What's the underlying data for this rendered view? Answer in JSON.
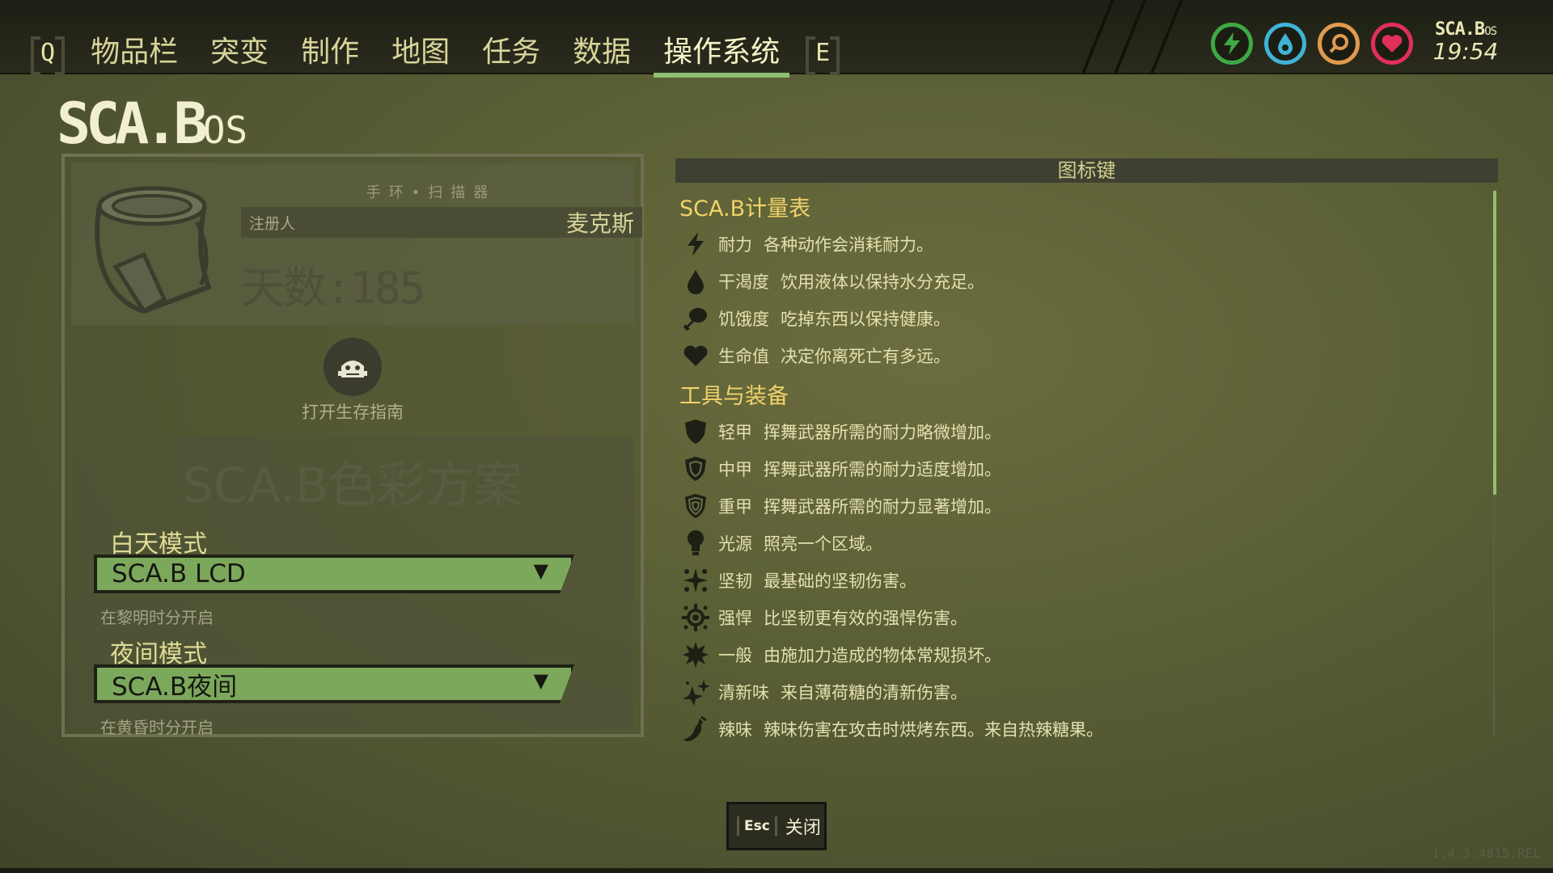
{
  "nav": {
    "left_key": "Q",
    "right_key": "E",
    "tabs": [
      "物品栏",
      "突变",
      "制作",
      "地图",
      "任务",
      "数据",
      "操作系统"
    ],
    "active_tab": "操作系统"
  },
  "status": {
    "icons": [
      {
        "name": "stamina-status-icon",
        "glyph": "⚡",
        "color": "#3fa845"
      },
      {
        "name": "thirst-status-icon",
        "glyph": "💧",
        "color": "#3fb4d6"
      },
      {
        "name": "hunger-status-icon",
        "glyph": "◔",
        "color": "#e09a4e"
      },
      {
        "name": "health-status-icon",
        "glyph": "♥",
        "color": "#e0305a"
      }
    ],
    "logo": "SCA.B",
    "logo_suffix": "OS",
    "time": "19:54"
  },
  "brand": {
    "logo": "SCA.B",
    "suffix": "OS"
  },
  "scanner": {
    "title": "手环•扫描器",
    "registrant_label": "注册人",
    "registrant_name": "麦克斯",
    "days": "天数:185"
  },
  "guide": {
    "label": "打开生存指南"
  },
  "color_scheme": {
    "title": "SCA.B色彩方案",
    "day": {
      "label": "白天模式",
      "value": "SCA.B LCD",
      "sub": "在黎明时分开启"
    },
    "night": {
      "label": "夜间模式",
      "value": "SCA.B夜间",
      "sub": "在黄昏时分开启"
    }
  },
  "legend": {
    "header": "图标键",
    "sections": [
      {
        "title": "SCA.B计量表",
        "items": [
          {
            "icon": "lightning-icon",
            "name": "耐力",
            "desc": "各种动作会消耗耐力。"
          },
          {
            "icon": "water-drop-icon",
            "name": "干渴度",
            "desc": "饮用液体以保持水分充足。"
          },
          {
            "icon": "drumstick-icon",
            "name": "饥饿度",
            "desc": "吃掉东西以保持健康。"
          },
          {
            "icon": "heart-icon",
            "name": "生命值",
            "desc": "决定你离死亡有多远。"
          }
        ]
      },
      {
        "title": "工具与装备",
        "items": [
          {
            "icon": "light-armor-shield-icon",
            "name": "轻甲",
            "desc": "挥舞武器所需的耐力略微增加。"
          },
          {
            "icon": "medium-armor-shield-icon",
            "name": "中甲",
            "desc": "挥舞武器所需的耐力适度增加。"
          },
          {
            "icon": "heavy-armor-shield-icon",
            "name": "重甲",
            "desc": "挥舞武器所需的耐力显著增加。"
          },
          {
            "icon": "light-source-bulb-icon",
            "name": "光源",
            "desc": "照亮一个区域。"
          },
          {
            "icon": "chop-damage-icon",
            "name": "坚韧",
            "desc": "最基础的坚韧伤害。"
          },
          {
            "icon": "bust-damage-icon",
            "name": "强悍",
            "desc": "比坚韧更有效的强悍伤害。"
          },
          {
            "icon": "generic-damage-burst-icon",
            "name": "一般",
            "desc": "由施加力造成的物体常规损坏。"
          },
          {
            "icon": "fresh-sparkle-icon",
            "name": "清新味",
            "desc": "来自薄荷糖的清新伤害。"
          },
          {
            "icon": "spicy-pepper-icon",
            "name": "辣味",
            "desc": "辣味伤害在攻击时烘烤东西。来自热辣糖果。"
          }
        ]
      }
    ]
  },
  "footer": {
    "esc_key": "Esc",
    "close_label": "关闭",
    "version": "1.4.3.4815.REL"
  }
}
